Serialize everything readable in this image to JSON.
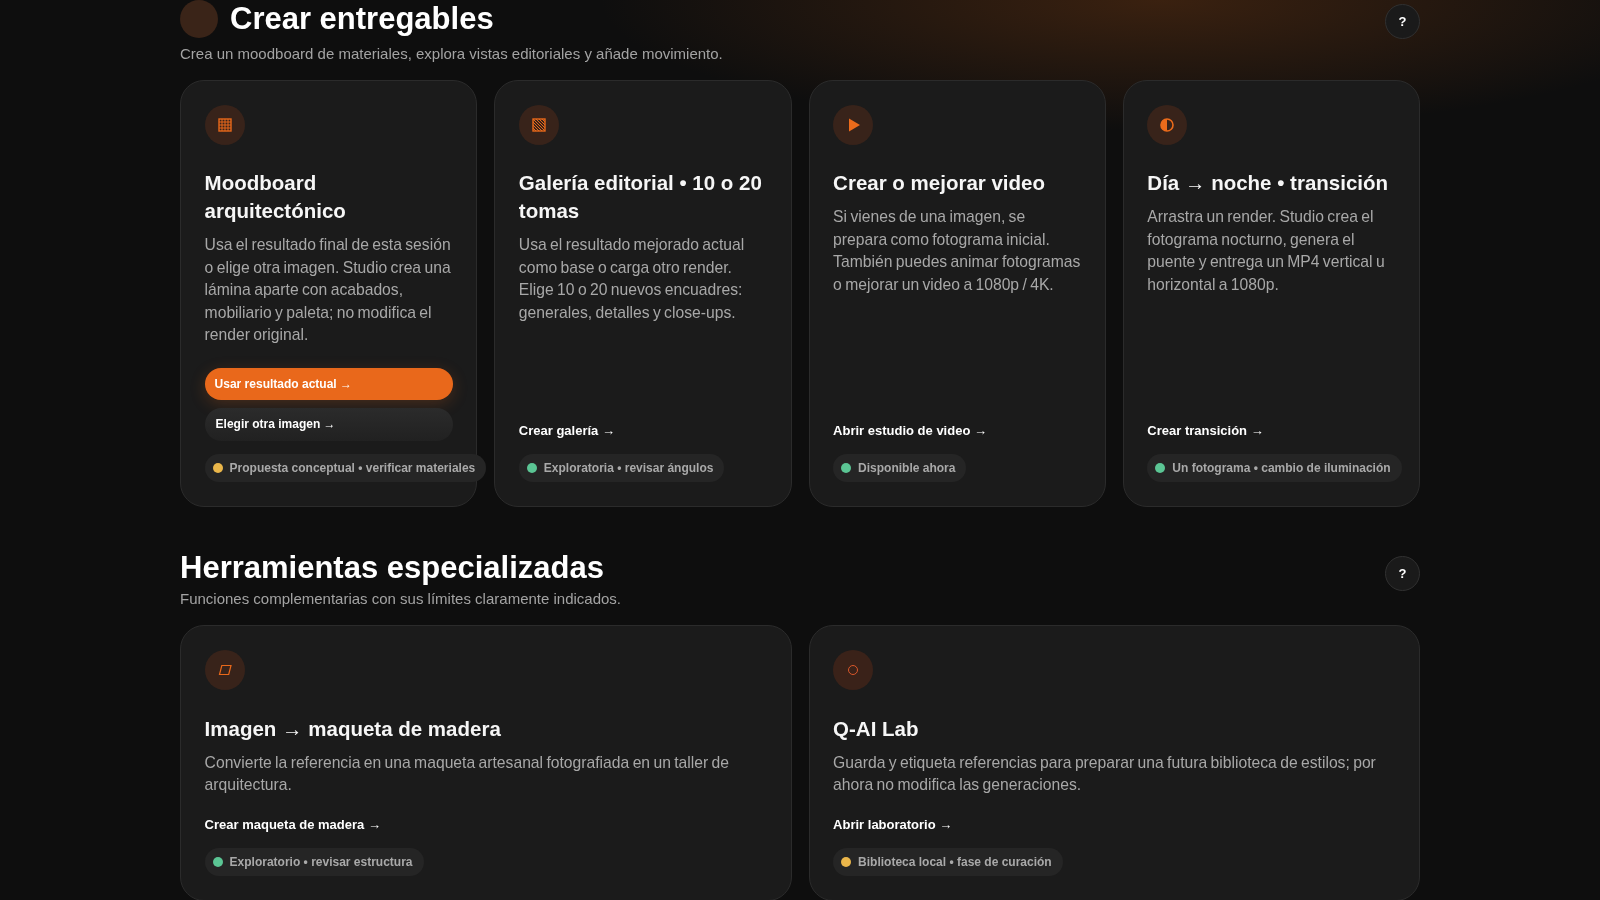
{
  "sections": [
    {
      "title": "Crear entregables",
      "badge": true,
      "subtitle": "Crea un moodboard de materiales, explora vistas editoriales y añade movimiento.",
      "help": "?",
      "cards": [
        {
          "title": "Moodboard arquitectónico",
          "description": "Usa el resultado final de esta sesión o elige otra imagen. Studio crea una lámina aparte con acabados, mobiliario y paleta; no modifica el render original.",
          "actions": [
            {
              "kind": "primary",
              "label": "Usar resultado actual →"
            },
            {
              "kind": "secondary",
              "label": "Elegir otra imagen →"
            }
          ],
          "status": {
            "label": "Propuesta conceptual • verificar materiales",
            "color": "#eab64a"
          }
        },
        {
          "title": "Galería editorial • 10 o 20 tomas",
          "description": "Usa el resultado mejorado actual como base o carga otro render. Elige 10 o 20 nuevos encuadres: generales, detalles y close-ups.",
          "actions": [
            {
              "kind": "link",
              "label": "Crear galería →"
            }
          ],
          "status": {
            "label": "Exploratoria • revisar ángulos",
            "color": "#5bc594"
          }
        },
        {
          "title": "Crear o mejorar video",
          "description": "Si vienes de una imagen, se prepara como fotograma inicial. También puedes animar fotogramas o mejorar un video a 1080p / 4K.",
          "actions": [
            {
              "kind": "link",
              "label": "Abrir estudio de video →"
            }
          ],
          "status": {
            "label": "Disponible ahora",
            "color": "#5bc594"
          }
        },
        {
          "title": "Día → noche • transición",
          "description": "Arrastra un render. Studio crea el fotograma nocturno, genera el puente y entrega un MP4 vertical u horizontal a 1080p.",
          "actions": [
            {
              "kind": "link",
              "label": "Crear transición →"
            }
          ],
          "status": {
            "label": "Un fotograma • cambio de iluminación",
            "color": "#5bc594"
          }
        }
      ]
    },
    {
      "title": "Herramientas especializadas",
      "subtitle": "Funciones complementarias con sus límites claramente indicados.",
      "help": "?",
      "cards": [
        {
          "title": "Imagen → maqueta de madera",
          "description": "Convierte la referencia en una maqueta artesanal fotografiada en un taller de arquitectura.",
          "actions": [
            {
              "kind": "link",
              "label": "Crear maqueta de madera →"
            }
          ],
          "status": {
            "label": "Exploratorio • revisar estructura",
            "color": "#5bc594"
          }
        },
        {
          "title": "Q-AI Lab",
          "description": "Guarda y etiqueta referencias para preparar una futura biblioteca de estilos; por ahora no modifica las generaciones.",
          "actions": [
            {
              "kind": "link",
              "label": "Abrir laboratorio →"
            }
          ],
          "status": {
            "label": "Biblioteca local • fase de curación",
            "color": "#eab64a"
          }
        }
      ]
    }
  ]
}
